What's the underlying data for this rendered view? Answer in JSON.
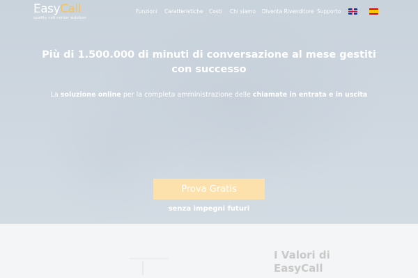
{
  "brand": {
    "logo_part1": "Easy",
    "logo_part2": "Call",
    "tagline": "quality call center solution"
  },
  "nav": {
    "items": [
      {
        "label": "Funzioni"
      },
      {
        "label": "Caratteristiche"
      },
      {
        "label": "Costi"
      },
      {
        "label": "Chi siamo"
      },
      {
        "label": "Diventa Rivenditore"
      },
      {
        "label": "Supporto"
      }
    ],
    "languages": [
      "English",
      "Español"
    ]
  },
  "hero": {
    "headline": {
      "p1": "Più di ",
      "b1": "1.500.000",
      "p2": " di minuti di conversazione al mese ",
      "b2": "gestiti con successo"
    },
    "subline": {
      "p1": "La ",
      "b1": "soluzione online",
      "p2": " per la completa amministrazione delle ",
      "b2": "chiamate in entrata e in uscita"
    },
    "cta_label": "Prova Gratis",
    "cta_note": "senza impegni futuri"
  },
  "values": {
    "title": "I Valori di EasyCall"
  },
  "colors": {
    "hero_bg": "#cdd6df",
    "accent": "#f6c35a",
    "cta_bg": "#fde1ad",
    "text_light": "#ffffff",
    "section_title": "#c9c9c9"
  }
}
